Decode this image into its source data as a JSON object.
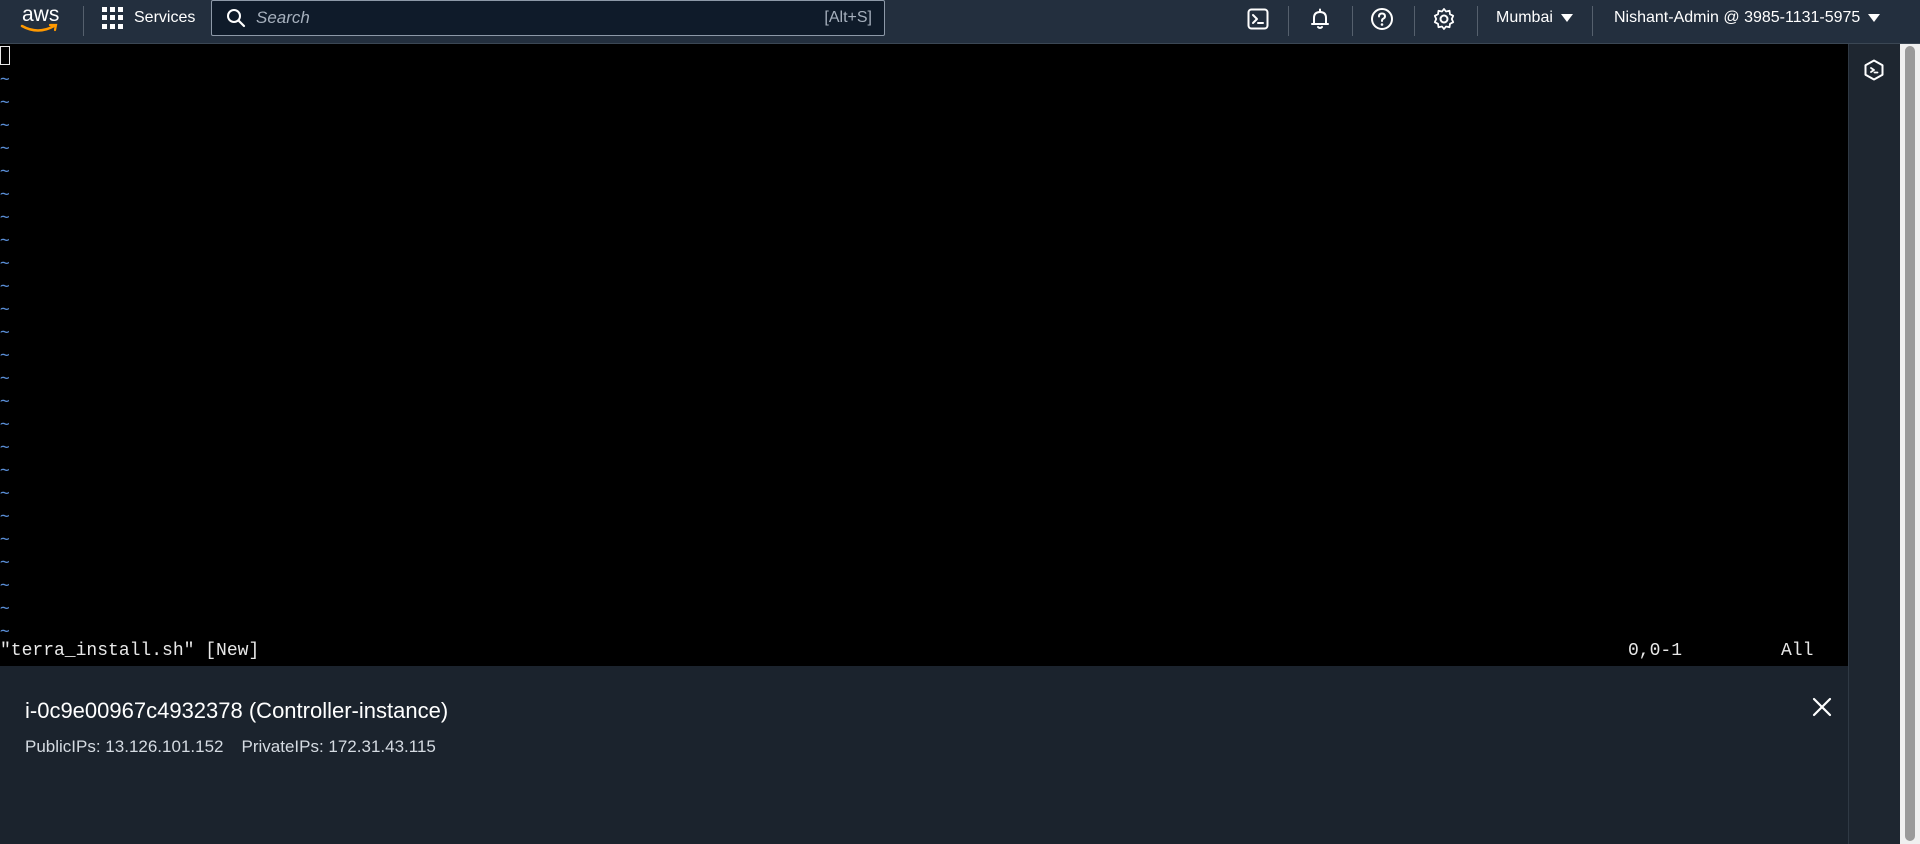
{
  "topbar": {
    "logo_text": "aws",
    "services_label": "Services",
    "search": {
      "placeholder": "Search",
      "value": "",
      "shortcut": "[Alt+S]"
    },
    "icons": [
      "cloudshell-icon",
      "notifications-icon",
      "help-icon",
      "settings-icon"
    ],
    "region": "Mumbai",
    "account": "Nishant-Admin @ 3985-1131-5975"
  },
  "terminal": {
    "tilde_char": "~",
    "tilde_line_count": 25,
    "status": {
      "file": "\"terra_install.sh\" [New]",
      "position": "0,0-1",
      "percent": "All"
    }
  },
  "instance": {
    "title": "i-0c9e00967c4932378 (Controller-instance)",
    "public_ips": "PublicIPs: 13.126.101.152",
    "private_ips": "PrivateIPs: 172.31.43.115"
  },
  "colors": {
    "topbar": "#232f3e",
    "panel": "#1b232d",
    "tilde": "#5a8fd8",
    "terminal_bg": "#000000"
  }
}
